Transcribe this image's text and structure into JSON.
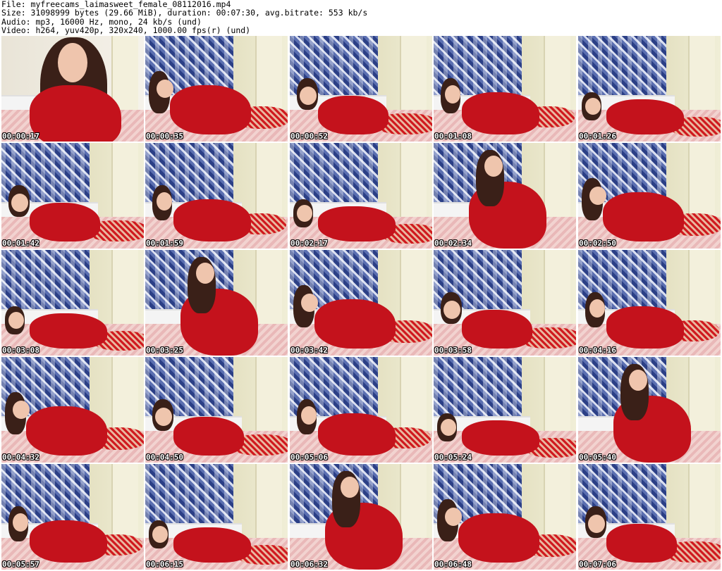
{
  "header": {
    "file_line": "File: myfreecams_laimasweet_female_08112016.mp4",
    "size_line": "Size: 31098999 bytes (29.66 MiB), duration: 00:07:30, avg.bitrate: 553 kb/s",
    "audio_line": "Audio: mp3, 16000 Hz, mono, 24 kb/s (und)",
    "video_line": "Video: h264, yuv420p, 320x240, 1000.00 fps(r) (und)"
  },
  "thumbnails": [
    "00:00:17",
    "00:00:35",
    "00:00:52",
    "00:01:08",
    "00:01:26",
    "00:01:42",
    "00:01:59",
    "00:02:17",
    "00:02:34",
    "00:02:50",
    "00:03:08",
    "00:03:25",
    "00:03:42",
    "00:03:58",
    "00:04:16",
    "00:04:32",
    "00:04:50",
    "00:05:06",
    "00:05:24",
    "00:05:40",
    "00:05:57",
    "00:06:15",
    "00:06:32",
    "00:06:48",
    "00:07:06"
  ],
  "colors": {
    "background": "#ffffff",
    "header_text": "#000000",
    "timestamp_text": "#ffffff",
    "dress": "#c4121c"
  }
}
